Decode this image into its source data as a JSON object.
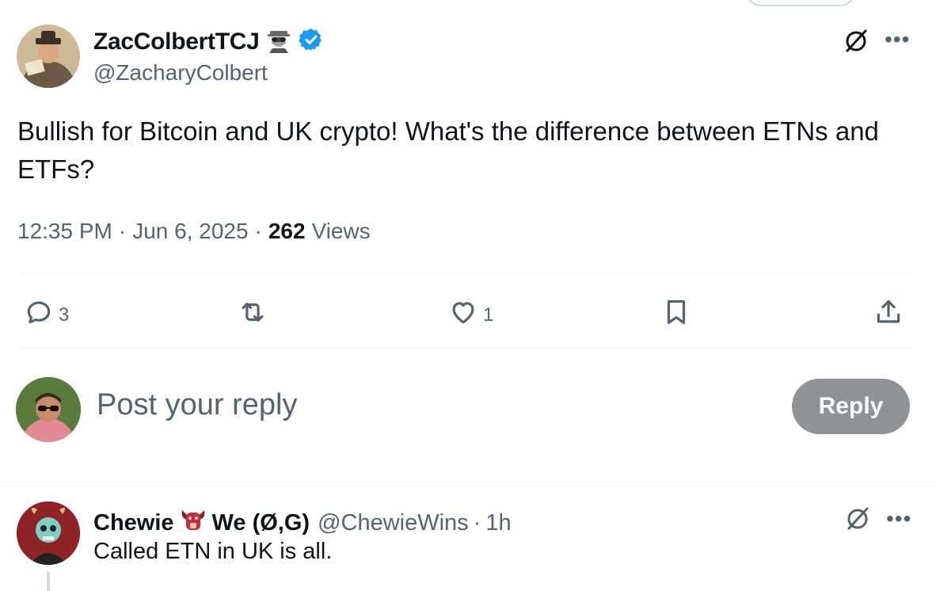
{
  "tweet": {
    "author_name": "ZacColbertTCJ",
    "author_handle": "@ZacharyColbert",
    "text": "Bullish for Bitcoin and UK crypto! What's the difference between ETNs and ETFs?",
    "time": "12:35 PM",
    "date": "Jun 6, 2025",
    "separator": "·",
    "views_count": "262",
    "views_label": "Views",
    "icons": [
      "spy-emoji-icon",
      "verified-badge-icon",
      "grok-icon",
      "more-icon"
    ]
  },
  "actions": {
    "reply_count": "3",
    "repost_count": "",
    "like_count": "1",
    "icons": [
      "reply-icon",
      "repost-icon",
      "like-icon",
      "bookmark-icon",
      "share-icon"
    ]
  },
  "composer": {
    "placeholder": "Post your reply",
    "button_label": "Reply"
  },
  "reply": {
    "name": "Chewie",
    "name_suffix": "We (Ø,G)",
    "handle": "@ChewieWins",
    "separator": "·",
    "time": "1h",
    "text": "Called ETN in UK is all."
  },
  "colors": {
    "text_primary": "#0f1419",
    "text_secondary": "#536471",
    "verified_blue": "#1d9bf0",
    "reply_button_bg": "#8f9396",
    "divider": "#eff3f4"
  }
}
